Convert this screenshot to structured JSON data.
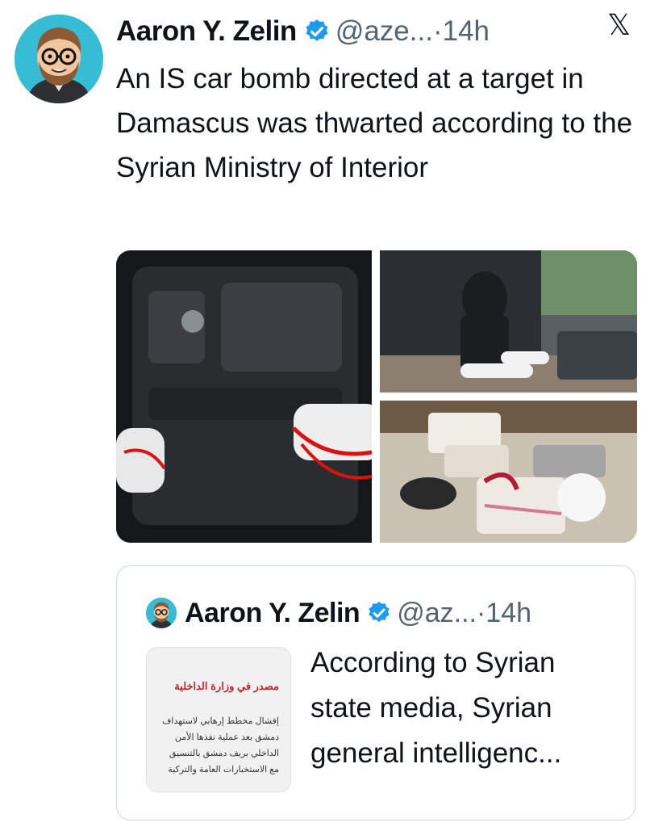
{
  "tweet": {
    "author_name": "Aaron Y. Zelin",
    "handle": "@aze...",
    "separator": "·",
    "time": "14h",
    "platform_logo": "𝕏",
    "text": "An IS car bomb directed at a target in Damascus was thwarted according to the Syrian Ministry of Interior"
  },
  "media": {
    "photos": [
      "car-underbody-photo",
      "officer-with-explosives-photo",
      "seized-materials-photo"
    ]
  },
  "quoted_tweet": {
    "author_name": "Aaron Y. Zelin",
    "handle": "@az...",
    "separator": "·",
    "time": "14h",
    "text": "According to Syrian state media, Syrian general intelligenc...",
    "thumbnail": {
      "title": "مصدر في وزارة الداخلية",
      "lines": [
        "إفشال مخطط إرهابي لاستهداف",
        "دمشق بعد عملية نفذها الأمن",
        "الداخلي بريف دمشق بالتنسيق",
        "مع الاستخبارات العامة والتركية"
      ]
    }
  },
  "colors": {
    "verified_blue": "#1d9bf0",
    "secondary_text": "#536471",
    "primary_text": "#0f1419",
    "border": "#cfd9de"
  }
}
